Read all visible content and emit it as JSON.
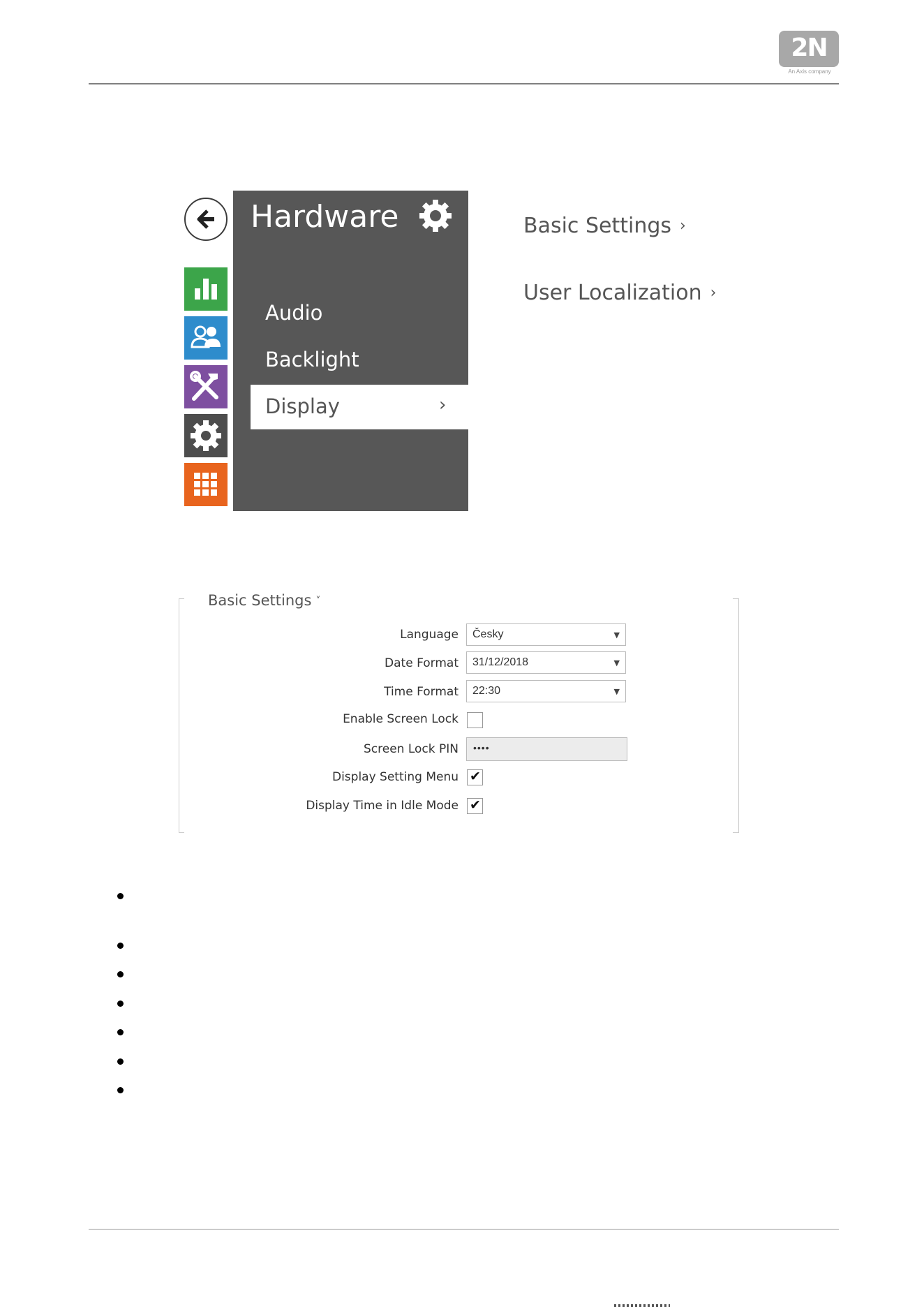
{
  "header": {
    "logo_text": "2N",
    "logo_subtitle": "An Axis company"
  },
  "side_nav": {
    "items": [
      {
        "icon": "bar-chart-icon",
        "color": "#3ca54a"
      },
      {
        "icon": "users-icon",
        "color": "#2e8ccc"
      },
      {
        "icon": "tools-icon",
        "color": "#7e4fa0"
      },
      {
        "icon": "gear-icon",
        "color": "#4d4d4d"
      },
      {
        "icon": "grid-icon",
        "color": "#e8641e"
      }
    ]
  },
  "hardware_panel": {
    "title": "Hardware",
    "items": [
      "Audio",
      "Backlight",
      "Display"
    ],
    "selected": "Display",
    "selected_chevron": "›"
  },
  "right_links": {
    "basic_settings": "Basic Settings",
    "user_localization": "User Localization",
    "chevron": "›"
  },
  "form": {
    "legend": "Basic Settings",
    "legend_chevron": "˅",
    "fields": {
      "language": {
        "label": "Language",
        "value": "Česky"
      },
      "date_format": {
        "label": "Date Format",
        "value": "31/12/2018"
      },
      "time_format": {
        "label": "Time Format",
        "value": "22:30"
      },
      "enable_screen_lock": {
        "label": "Enable Screen Lock",
        "checked": false
      },
      "screen_lock_pin": {
        "label": "Screen Lock PIN",
        "value": "••••"
      },
      "display_setting_menu": {
        "label": "Display Setting Menu",
        "checked": true
      },
      "display_time_idle": {
        "label": "Display Time in Idle Mode",
        "checked": true
      }
    },
    "select_arrow": "▼",
    "check_mark": "✔"
  }
}
